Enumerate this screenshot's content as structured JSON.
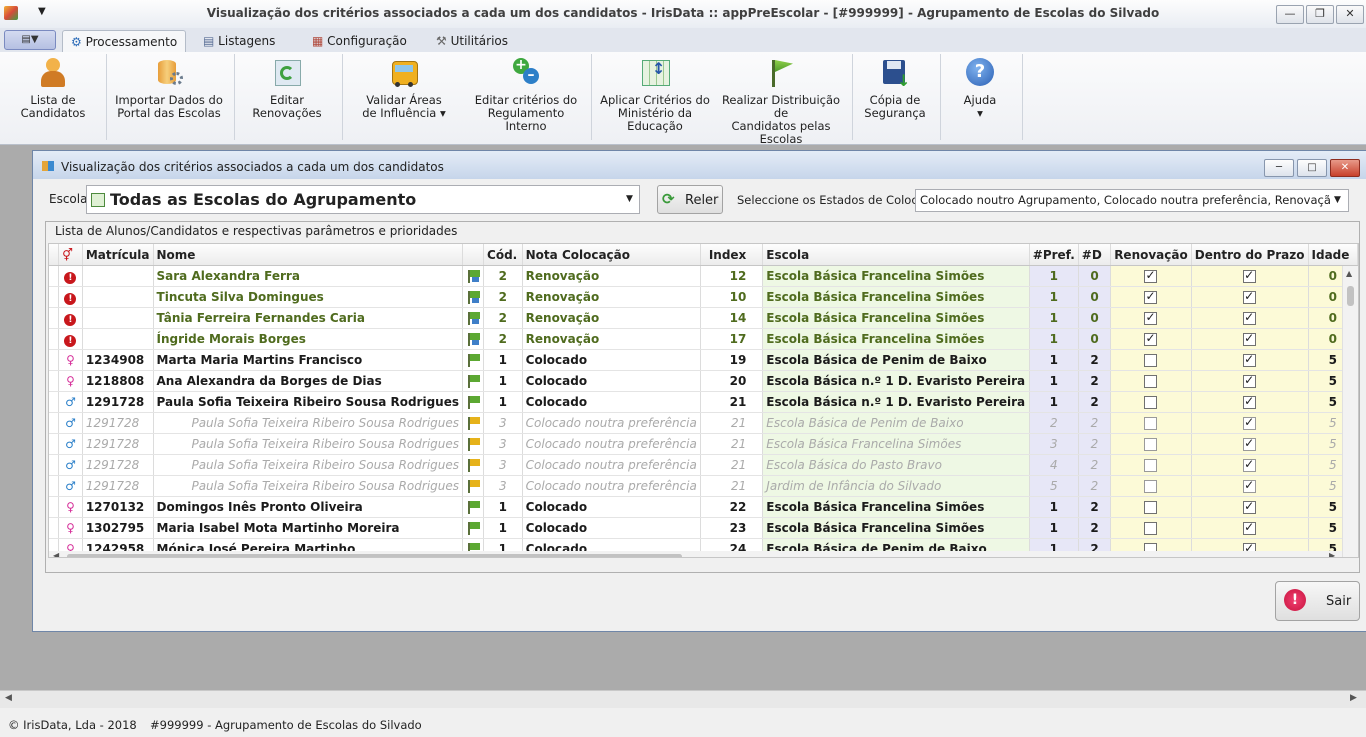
{
  "window": {
    "title": "Visualização dos critérios associados a cada um dos candidatos - IrisData :: appPreEscolar - [#999999] - Agrupamento de Escolas do Silvado",
    "buttons": {
      "minimize": "—",
      "restore": "❐",
      "close": "✕"
    }
  },
  "tabs": [
    {
      "label": "Processamento",
      "active": true
    },
    {
      "label": "Listagens"
    },
    {
      "label": "Configuração"
    },
    {
      "label": "Utilitários"
    }
  ],
  "ribbon": {
    "candidatos": {
      "line1": "Lista de",
      "line2": "Candidatos"
    },
    "importar": {
      "line1": "Importar Dados do",
      "line2": "Portal das Escolas"
    },
    "renovacoes": {
      "line1": "Editar",
      "line2": "Renovações"
    },
    "areas": {
      "line1": "Validar Áreas",
      "line2": "de Influência ▾"
    },
    "criterios": {
      "line1": "Editar critérios do",
      "line2": "Regulamento Interno"
    },
    "aplicar": {
      "line1": "Aplicar Critérios do",
      "line2": "Ministério da Educação"
    },
    "distribuicao": {
      "line1": "Realizar Distribuição de",
      "line2": "Candidatos pelas Escolas"
    },
    "copia": {
      "line1": "Cópia de",
      "line2": "Segurança"
    },
    "ajuda": {
      "line1": "Ajuda",
      "line2": "▾"
    }
  },
  "child": {
    "title": "Visualização dos critérios associados a cada um dos candidatos",
    "escola_label": "Escola",
    "escola_value": "Todas as Escolas do Agrupamento",
    "reler_label": "Reler",
    "estados_label": "Seleccione os Estados de Colocação",
    "estados_value": "Colocado noutro Agrupamento, Colocado noutra preferência, Renovação, Coloca...",
    "group_label": "Lista de Alunos/Candidatos e respectivas parâmetros e prioridades",
    "sair_label": "Sair"
  },
  "grid": {
    "headers": {
      "matricula": "Matrícula",
      "nome": "Nome",
      "cod": "Cód.",
      "nota": "Nota Colocação",
      "index": "Index",
      "escola": "Escola",
      "pref": "#Pref.",
      "d": "#D",
      "renovacao": "Renovação",
      "prazo": "Dentro do Prazo",
      "idade": "Idade"
    },
    "rows": [
      {
        "type": "ren",
        "icon": "!",
        "matricula": "",
        "nome": "Sara Alexandra Ferra",
        "flag": "multi",
        "cod": "2",
        "nota": "Renovação",
        "index": "12",
        "escola": "Escola Básica Francelina Simões",
        "pref": "1",
        "d": "0",
        "renovacao": true,
        "prazo": true,
        "idade": "0"
      },
      {
        "type": "ren",
        "icon": "!",
        "matricula": "",
        "nome": "Tincuta Silva Domingues",
        "flag": "multi",
        "cod": "2",
        "nota": "Renovação",
        "index": "10",
        "escola": "Escola Básica Francelina Simões",
        "pref": "1",
        "d": "0",
        "renovacao": true,
        "prazo": true,
        "idade": "0"
      },
      {
        "type": "ren",
        "icon": "!",
        "matricula": "",
        "nome": "Tânia Ferreira Fernandes Caria",
        "flag": "multi",
        "cod": "2",
        "nota": "Renovação",
        "index": "14",
        "escola": "Escola Básica Francelina Simões",
        "pref": "1",
        "d": "0",
        "renovacao": true,
        "prazo": true,
        "idade": "0"
      },
      {
        "type": "ren",
        "icon": "!",
        "matricula": "",
        "nome": "Íngride Morais Borges",
        "flag": "multi",
        "cod": "2",
        "nota": "Renovação",
        "index": "17",
        "escola": "Escola Básica Francelina Simões",
        "pref": "1",
        "d": "0",
        "renovacao": true,
        "prazo": true,
        "idade": "0"
      },
      {
        "type": "col",
        "icon": "f",
        "matricula": "1234908",
        "nome": "Marta Maria Martins Francisco",
        "flag": "green",
        "cod": "1",
        "nota": "Colocado",
        "index": "19",
        "escola": "Escola Básica de Penim de Baixo",
        "pref": "1",
        "d": "2",
        "renovacao": false,
        "prazo": true,
        "idade": "5"
      },
      {
        "type": "col",
        "icon": "f",
        "matricula": "1218808",
        "nome": "Ana Alexandra da Borges de Dias",
        "flag": "green",
        "cod": "1",
        "nota": "Colocado",
        "index": "20",
        "escola": "Escola Básica n.º 1 D. Evaristo Pereira",
        "pref": "1",
        "d": "2",
        "renovacao": false,
        "prazo": true,
        "idade": "5"
      },
      {
        "type": "col",
        "icon": "m",
        "matricula": "1291728",
        "nome": "Paula Sofia Teixeira Ribeiro Sousa Rodrigues",
        "flag": "green",
        "cod": "1",
        "nota": "Colocado",
        "index": "21",
        "escola": "Escola Básica n.º 1 D. Evaristo Pereira",
        "pref": "1",
        "d": "2",
        "renovacao": false,
        "prazo": true,
        "idade": "5"
      },
      {
        "type": "ghost",
        "icon": "m",
        "matricula": "1291728",
        "nome": "Paula Sofia Teixeira Ribeiro Sousa Rodrigues",
        "flag": "yellow",
        "cod": "3",
        "nota": "Colocado noutra preferência",
        "index": "21",
        "escola": "Escola Básica de Penim de Baixo",
        "pref": "2",
        "d": "2",
        "renovacao": false,
        "prazo": true,
        "idade": "5"
      },
      {
        "type": "ghost",
        "icon": "m",
        "matricula": "1291728",
        "nome": "Paula Sofia Teixeira Ribeiro Sousa Rodrigues",
        "flag": "yellow",
        "cod": "3",
        "nota": "Colocado noutra preferência",
        "index": "21",
        "escola": "Escola Básica Francelina Simões",
        "pref": "3",
        "d": "2",
        "renovacao": false,
        "prazo": true,
        "idade": "5"
      },
      {
        "type": "ghost",
        "icon": "m",
        "matricula": "1291728",
        "nome": "Paula Sofia Teixeira Ribeiro Sousa Rodrigues",
        "flag": "yellow",
        "cod": "3",
        "nota": "Colocado noutra preferência",
        "index": "21",
        "escola": "Escola Básica do Pasto Bravo",
        "pref": "4",
        "d": "2",
        "renovacao": false,
        "prazo": true,
        "idade": "5"
      },
      {
        "type": "ghost",
        "icon": "m",
        "matricula": "1291728",
        "nome": "Paula Sofia Teixeira Ribeiro Sousa Rodrigues",
        "flag": "yellow",
        "cod": "3",
        "nota": "Colocado noutra preferência",
        "index": "21",
        "escola": "Jardim de Infância do Silvado",
        "pref": "5",
        "d": "2",
        "renovacao": false,
        "prazo": true,
        "idade": "5"
      },
      {
        "type": "col",
        "icon": "f",
        "matricula": "1270132",
        "nome": "Domingos Inês Pronto Oliveira",
        "flag": "green",
        "cod": "1",
        "nota": "Colocado",
        "index": "22",
        "escola": "Escola Básica Francelina Simões",
        "pref": "1",
        "d": "2",
        "renovacao": false,
        "prazo": true,
        "idade": "5"
      },
      {
        "type": "col",
        "icon": "f",
        "matricula": "1302795",
        "nome": "Maria Isabel Mota Martinho Moreira",
        "flag": "green",
        "cod": "1",
        "nota": "Colocado",
        "index": "23",
        "escola": "Escola Básica Francelina Simões",
        "pref": "1",
        "d": "2",
        "renovacao": false,
        "prazo": true,
        "idade": "5"
      },
      {
        "type": "col",
        "icon": "f",
        "matricula": "1242958",
        "nome": "Mónica José Pereira Martinho",
        "flag": "green",
        "cod": "1",
        "nota": "Colocado",
        "index": "24",
        "escola": "Escola Básica de Penim de Baixo",
        "pref": "1",
        "d": "2",
        "renovacao": false,
        "prazo": true,
        "idade": "5"
      }
    ]
  },
  "status": {
    "copyright": "© IrisData, Lda - 2018",
    "school": "#999999 - Agrupamento de Escolas do Silvado"
  },
  "colors": {
    "renovacao_text": "#4f6b1e",
    "warning": "#c8171c",
    "female": "#d6339b",
    "male": "#2a7fc9",
    "escola_bg": "#eef8e4",
    "yellow_bg": "#fcfad7"
  }
}
